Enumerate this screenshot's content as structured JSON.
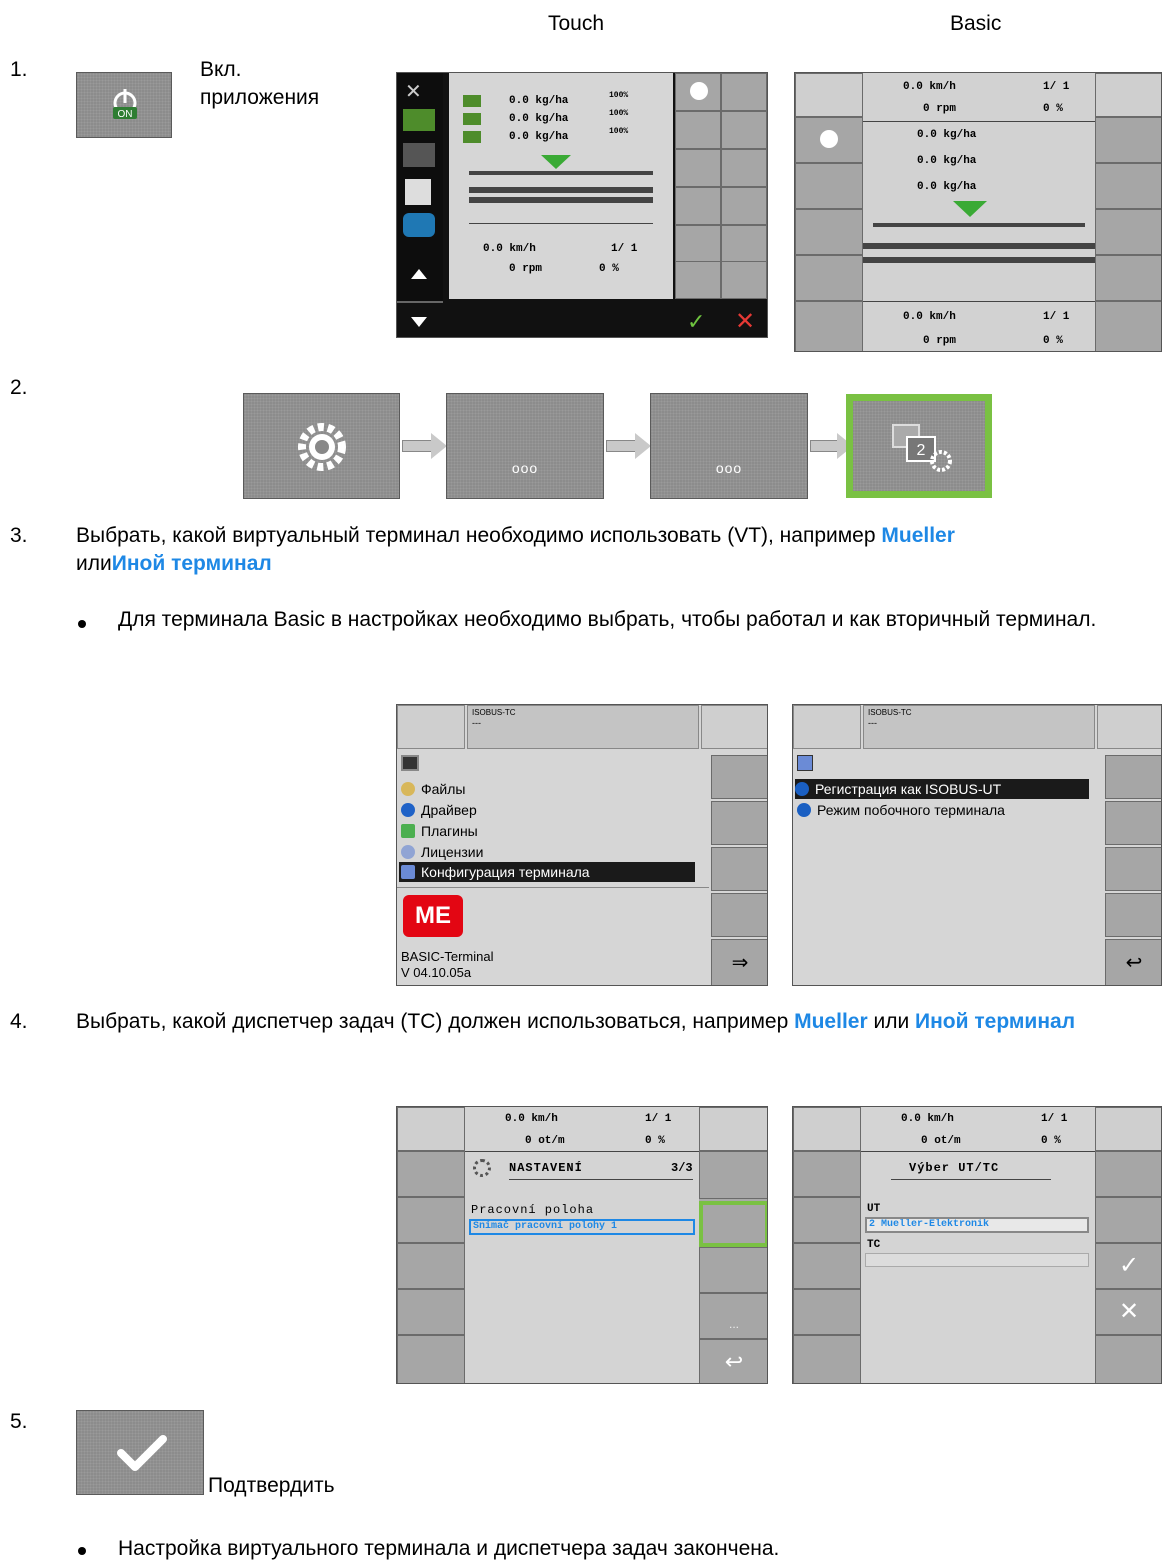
{
  "header": {
    "touch": "Touch",
    "basic": "Basic"
  },
  "steps": [
    {
      "num": "1.",
      "label": "Вкл.\nприложения"
    },
    {
      "num": "2."
    },
    {
      "num": "3.",
      "text_a": "Выбрать, какой виртуальный терминал необходимо использовать (VT), например ",
      "link1": "Mueller",
      "text_b": "или",
      "link2": "Иной терминал",
      "bullet": "Для терминала Basic в настройках необходимо выбрать, чтобы работал и как вторичный терминал."
    },
    {
      "num": "4.",
      "text_a": "Выбрать, какой диспетчер задач (TC) должен использоваться, например ",
      "link1": "Mueller",
      "text_b": " или ",
      "link2": "Иной терминал"
    },
    {
      "num": "5.",
      "label": "Подтвердить",
      "bullet": "Настройка виртуального терминала и диспетчера задач закончена."
    }
  ],
  "icons": {
    "on_button": "ON",
    "dots": "ooo",
    "dots2": "ooo",
    "vt_icon": "2"
  },
  "touch_screen": {
    "rows": [
      "0.0 kg/ha",
      "0.0 kg/ha",
      "0.0 kg/ha"
    ],
    "pct": [
      "100%",
      "100%",
      "100%"
    ],
    "speed": "0.0 km/h",
    "rpm": "0 rpm",
    "ratio": "1/ 1",
    "zero_pct": "0 %"
  },
  "basic_screen": {
    "speed": "0.0 km/h",
    "rpm": "0 rpm",
    "ratio": "1/ 1",
    "rows": [
      "0.0 kg/ha",
      "0.0 kg/ha",
      "0.0 kg/ha"
    ],
    "zero_pct": "0 %"
  },
  "menu_screen": {
    "title": "ISOBUS-TC",
    "sub": "---",
    "items": [
      "Файлы",
      "Драйвер",
      "Плагины",
      "Лицензии",
      "Конфигурация терминала"
    ],
    "logo": "ME",
    "product": "BASIC-Terminal",
    "version": "V 04.10.05a"
  },
  "reg_screen": {
    "title": "ISOBUS-TC",
    "sub": "---",
    "items": [
      "Регистрация как ISOBUS-UT",
      "Режим побочного терминала"
    ]
  },
  "nast_screen": {
    "speed": "0.0 km/h",
    "rpm": "0 ot/m",
    "ratio": "1/ 1",
    "pct": "0 %",
    "title": "NASTAVENÍ",
    "page": "3/3",
    "label": "Pracovní poloha",
    "value": "Snímač pracovní polohy 1",
    "more": "..."
  },
  "uttc_screen": {
    "speed": "0.0 km/h",
    "rpm": "0 ot/m",
    "ratio": "1/ 1",
    "pct": "0 %",
    "title": "Výber UT/TC",
    "ut": "UT",
    "ut_value": "2 Mueller-Elektronik",
    "tc": "TC"
  }
}
